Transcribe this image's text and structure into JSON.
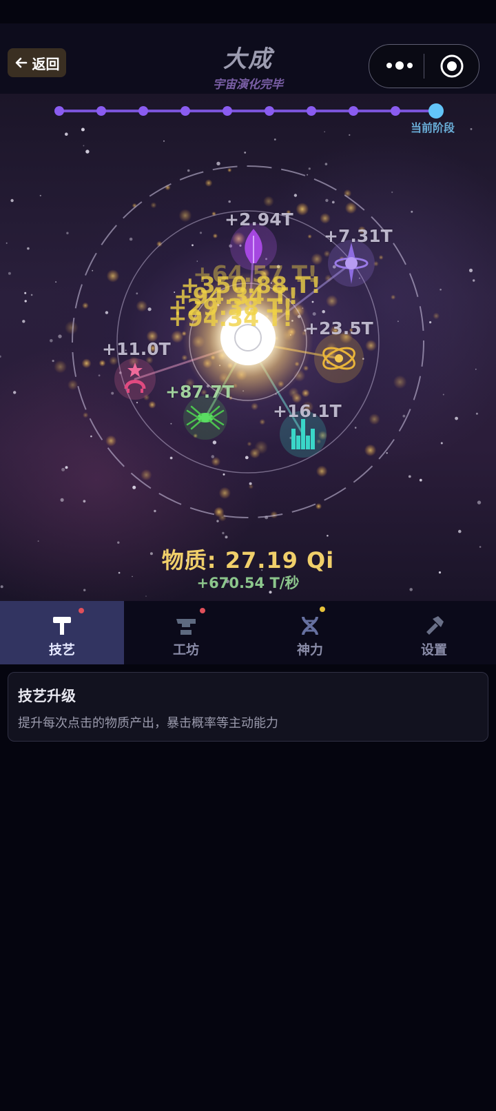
{
  "header": {
    "back_label": "返回",
    "title": "大成",
    "subtitle": "宇宙演化完毕"
  },
  "stage_track": {
    "total_stages": 10,
    "current_stage": 10,
    "current_label": "当前阶段"
  },
  "scene": {
    "planet_gains": [
      {
        "name": "crystal-flame",
        "label": "+2.94T",
        "color": "#b057e8"
      },
      {
        "name": "spinning-star",
        "label": "+7.31T",
        "color": "#9a7ae8"
      },
      {
        "name": "atom",
        "label": "+23.5T",
        "color": "#e8b43a"
      },
      {
        "name": "star-creature",
        "label": "+11.0T",
        "color": "#e86a9a"
      },
      {
        "name": "insect",
        "label": "+87.7T",
        "color": "#52d45a"
      },
      {
        "name": "tower-city",
        "label": "+16.1T",
        "color": "#3ad6c8"
      }
    ],
    "floating_texts": [
      "+64.57 T!",
      "+350.88 T!",
      "+94.34 T!",
      "+29.38 T!",
      "+94.34 T!"
    ]
  },
  "resources": {
    "matter_label": "物质: 27.19 Qi",
    "rate_label": "+670.54 T/秒"
  },
  "tabs": [
    {
      "label": "技艺",
      "icon": "hammer-icon",
      "active": true,
      "badge_color": "#e0505a"
    },
    {
      "label": "工坊",
      "icon": "anvil-icon",
      "active": false,
      "badge_color": "#e0505a"
    },
    {
      "label": "神力",
      "icon": "dna-icon",
      "active": false,
      "badge_color": "#e6c23a"
    },
    {
      "label": "设置",
      "icon": "wrench-icon",
      "active": false,
      "badge_color": null
    }
  ],
  "panel": {
    "title": "技艺升级",
    "description": "提升每次点击的物质产出，暴击概率等主动能力"
  }
}
